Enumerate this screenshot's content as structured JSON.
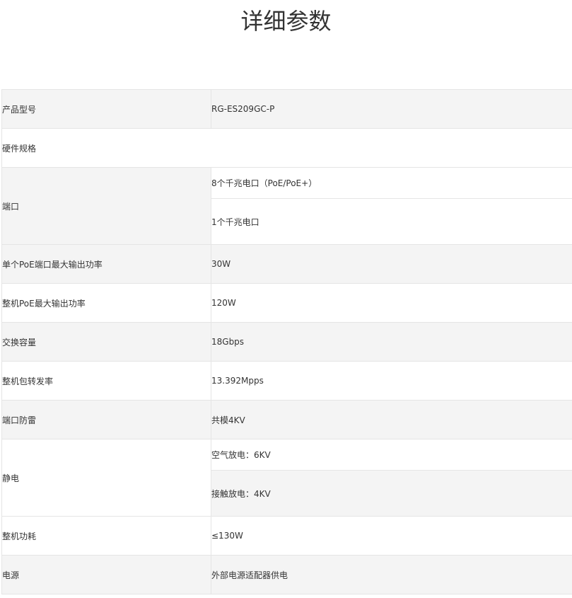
{
  "page": {
    "title": "详细参数"
  },
  "spec": {
    "model_label": "产品型号",
    "model_value": "RG-ES209GC-P",
    "hardware_label": "硬件规格",
    "port_label": "端口",
    "port_values": [
      "8个千兆电口（PoE/PoE+）",
      "1个千兆电口"
    ],
    "single_poe_label": "单个PoE端口最大输出功率",
    "single_poe_value": "30W",
    "total_poe_label": "整机PoE最大输出功率",
    "total_poe_value": "120W",
    "switching_label": "交换容量",
    "switching_value": "18Gbps",
    "forwarding_label": "整机包转发率",
    "forwarding_value": "13.392Mpps",
    "surge_label": "端口防雷",
    "surge_value": "共模4KV",
    "esd_label": "静电",
    "esd_values": [
      "空气放电：6KV",
      "接触放电：4KV"
    ],
    "power_consumption_label": "整机功耗",
    "power_consumption_value": "≤130W",
    "power_supply_label": "电源",
    "power_supply_value": "外部电源适配器供电"
  }
}
